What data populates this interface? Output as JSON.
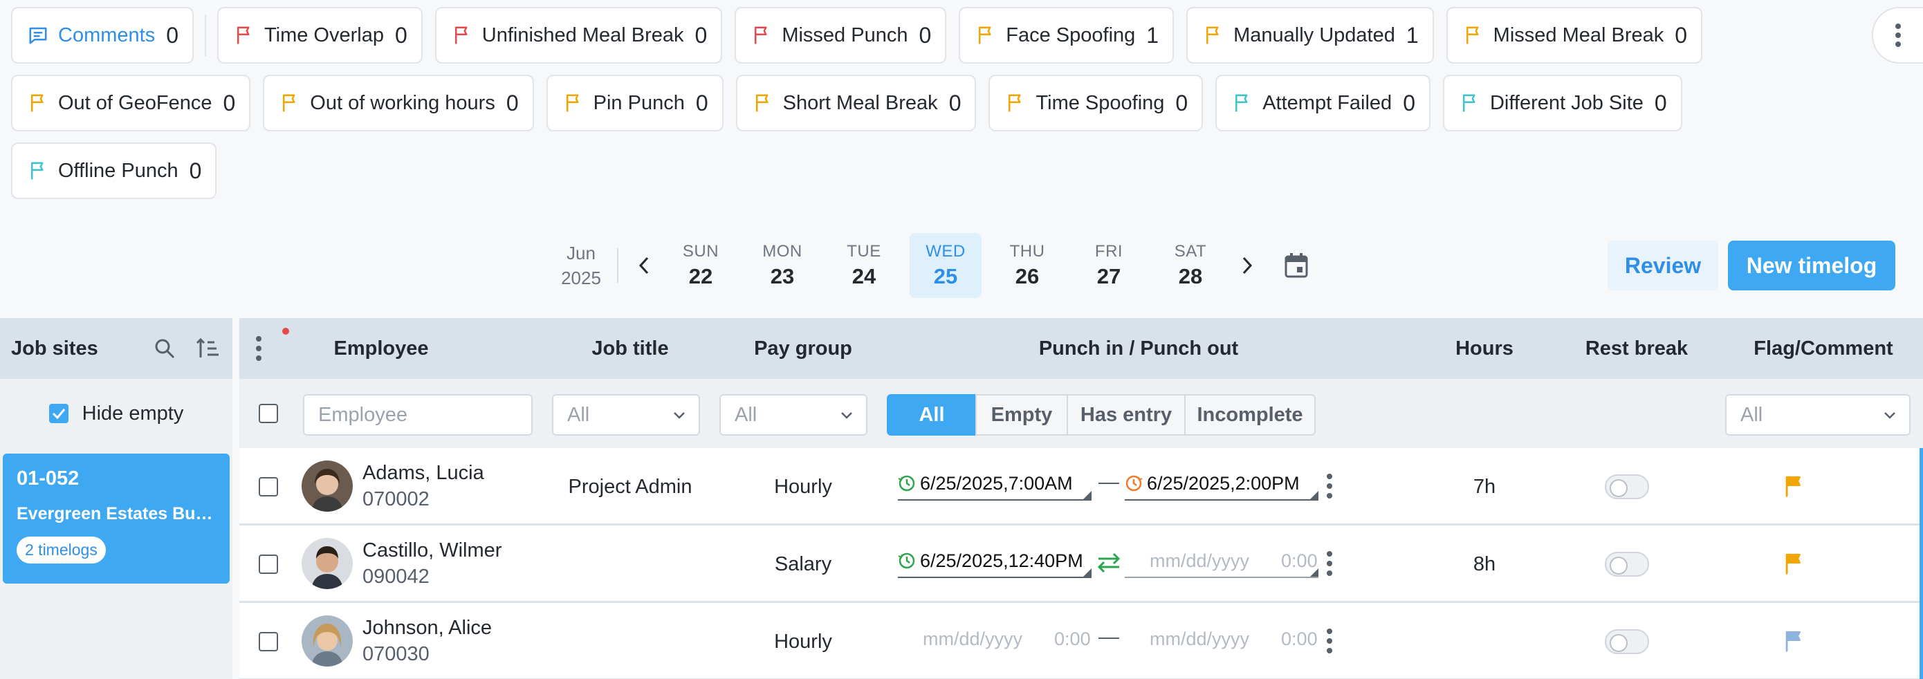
{
  "filters": {
    "row1": [
      {
        "label": "Comments",
        "count": "0",
        "icon": "comment-icon",
        "color": "#2f8fe8"
      },
      {
        "label": "Time Overlap",
        "count": "0",
        "icon": "flag-icon",
        "color": "#e5484d"
      },
      {
        "label": "Unfinished Meal Break",
        "count": "0",
        "icon": "flag-icon",
        "color": "#e5484d"
      },
      {
        "label": "Missed Punch",
        "count": "0",
        "icon": "flag-icon",
        "color": "#e5484d"
      },
      {
        "label": "Face Spoofing",
        "count": "1",
        "icon": "flag-icon",
        "color": "#f0a500"
      },
      {
        "label": "Manually Updated",
        "count": "1",
        "icon": "flag-icon",
        "color": "#f0a500"
      },
      {
        "label": "Missed Meal Break",
        "count": "0",
        "icon": "flag-icon",
        "color": "#f0a500"
      }
    ],
    "row2": [
      {
        "label": "Out of GeoFence",
        "count": "0",
        "icon": "flag-icon",
        "color": "#f0a500"
      },
      {
        "label": "Out of working hours",
        "count": "0",
        "icon": "flag-icon",
        "color": "#f0a500"
      },
      {
        "label": "Pin Punch",
        "count": "0",
        "icon": "flag-icon",
        "color": "#f0a500"
      },
      {
        "label": "Short Meal Break",
        "count": "0",
        "icon": "flag-icon",
        "color": "#f0a500"
      },
      {
        "label": "Time Spoofing",
        "count": "0",
        "icon": "flag-icon",
        "color": "#f0a500"
      },
      {
        "label": "Attempt Failed",
        "count": "0",
        "icon": "flag-icon",
        "color": "#3cc4cf"
      },
      {
        "label": "Different Job Site",
        "count": "0",
        "icon": "flag-icon",
        "color": "#3cc4cf"
      }
    ],
    "row3": [
      {
        "label": "Offline Punch",
        "count": "0",
        "icon": "flag-icon",
        "color": "#3cc4cf"
      }
    ]
  },
  "week": {
    "month": "Jun",
    "year": "2025",
    "days": [
      {
        "name": "SUN",
        "date": "22",
        "active": false
      },
      {
        "name": "MON",
        "date": "23",
        "active": false
      },
      {
        "name": "TUE",
        "date": "24",
        "active": false
      },
      {
        "name": "WED",
        "date": "25",
        "active": true
      },
      {
        "name": "THU",
        "date": "26",
        "active": false
      },
      {
        "name": "FRI",
        "date": "27",
        "active": false
      },
      {
        "name": "SAT",
        "date": "28",
        "active": false
      }
    ]
  },
  "actions": {
    "review": "Review",
    "new_timelog": "New timelog"
  },
  "sites": {
    "title": "Job sites",
    "hide_empty": "Hide empty",
    "items": [
      {
        "code": "01-052",
        "name": "Evergreen Estates Buil...",
        "badge": "2 timelogs"
      }
    ]
  },
  "table": {
    "headers": {
      "employee": "Employee",
      "job_title": "Job title",
      "pay_group": "Pay group",
      "punch": "Punch in / Punch out",
      "hours": "Hours",
      "rest_break": "Rest break",
      "flag_comment": "Flag/Comment"
    },
    "filters": {
      "employee_placeholder": "Employee",
      "job_title": "All",
      "pay_group": "All",
      "flag": "All",
      "segments": [
        "All",
        "Empty",
        "Has entry",
        "Incomplete"
      ]
    },
    "rows": [
      {
        "name": "Adams, Lucia",
        "id": "070002",
        "job_title": "Project Admin",
        "pay_group": "Hourly",
        "punch_in": "6/25/2025,7:00AM",
        "punch_out": "6/25/2025,2:00PM",
        "hours": "7h",
        "flag_color": "#f0a500"
      },
      {
        "name": "Castillo, Wilmer",
        "id": "090042",
        "job_title": "",
        "pay_group": "Salary",
        "punch_in": "6/25/2025,12:40PM",
        "punch_out_date": "mm/dd/yyyy",
        "punch_out_time": "0:00",
        "hours": "8h",
        "flag_color": "#f0a500"
      },
      {
        "name": "Johnson, Alice",
        "id": "070030",
        "job_title": "",
        "pay_group": "Hourly",
        "punch_in_date": "mm/dd/yyyy",
        "punch_in_time": "0:00",
        "punch_out_date": "mm/dd/yyyy",
        "punch_out_time": "0:00",
        "hours": "",
        "flag_color": "#8fb3dc"
      }
    ]
  }
}
